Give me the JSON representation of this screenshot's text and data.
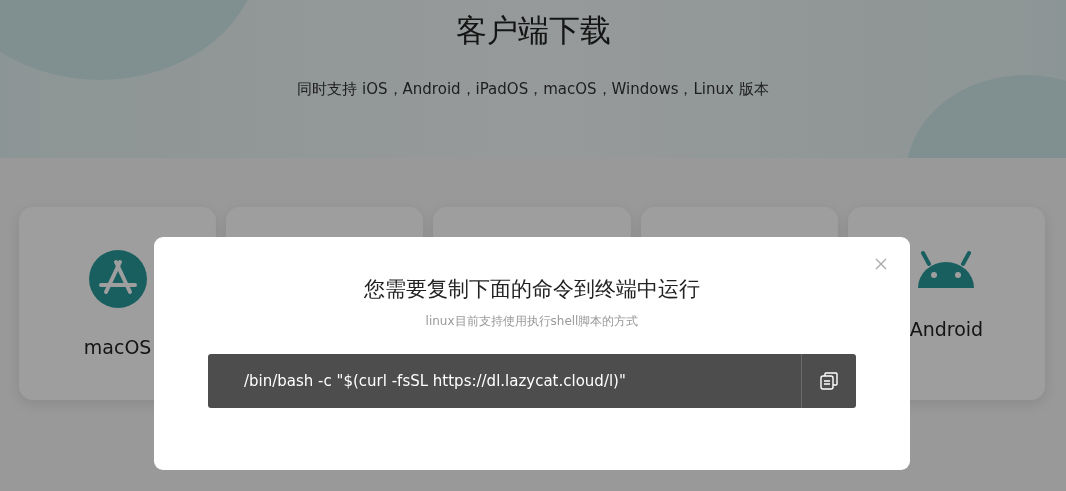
{
  "header": {
    "title": "客户端下载",
    "subtitle": "同时支持 iOS，Android，iPadOS，macOS，Windows，Linux 版本"
  },
  "cards": [
    {
      "kind": "appstore",
      "label": "macOS"
    },
    {
      "kind": "blank"
    },
    {
      "kind": "blank"
    },
    {
      "kind": "blank"
    },
    {
      "kind": "android",
      "label": "Android"
    }
  ],
  "dialog": {
    "title": "您需要复制下面的命令到终端中运行",
    "subtitle": "linux目前支持使用执行shell脚本的方式",
    "command": "/bin/bash -c \"$(curl -fsSL https://dl.lazycat.cloud/l)\""
  }
}
